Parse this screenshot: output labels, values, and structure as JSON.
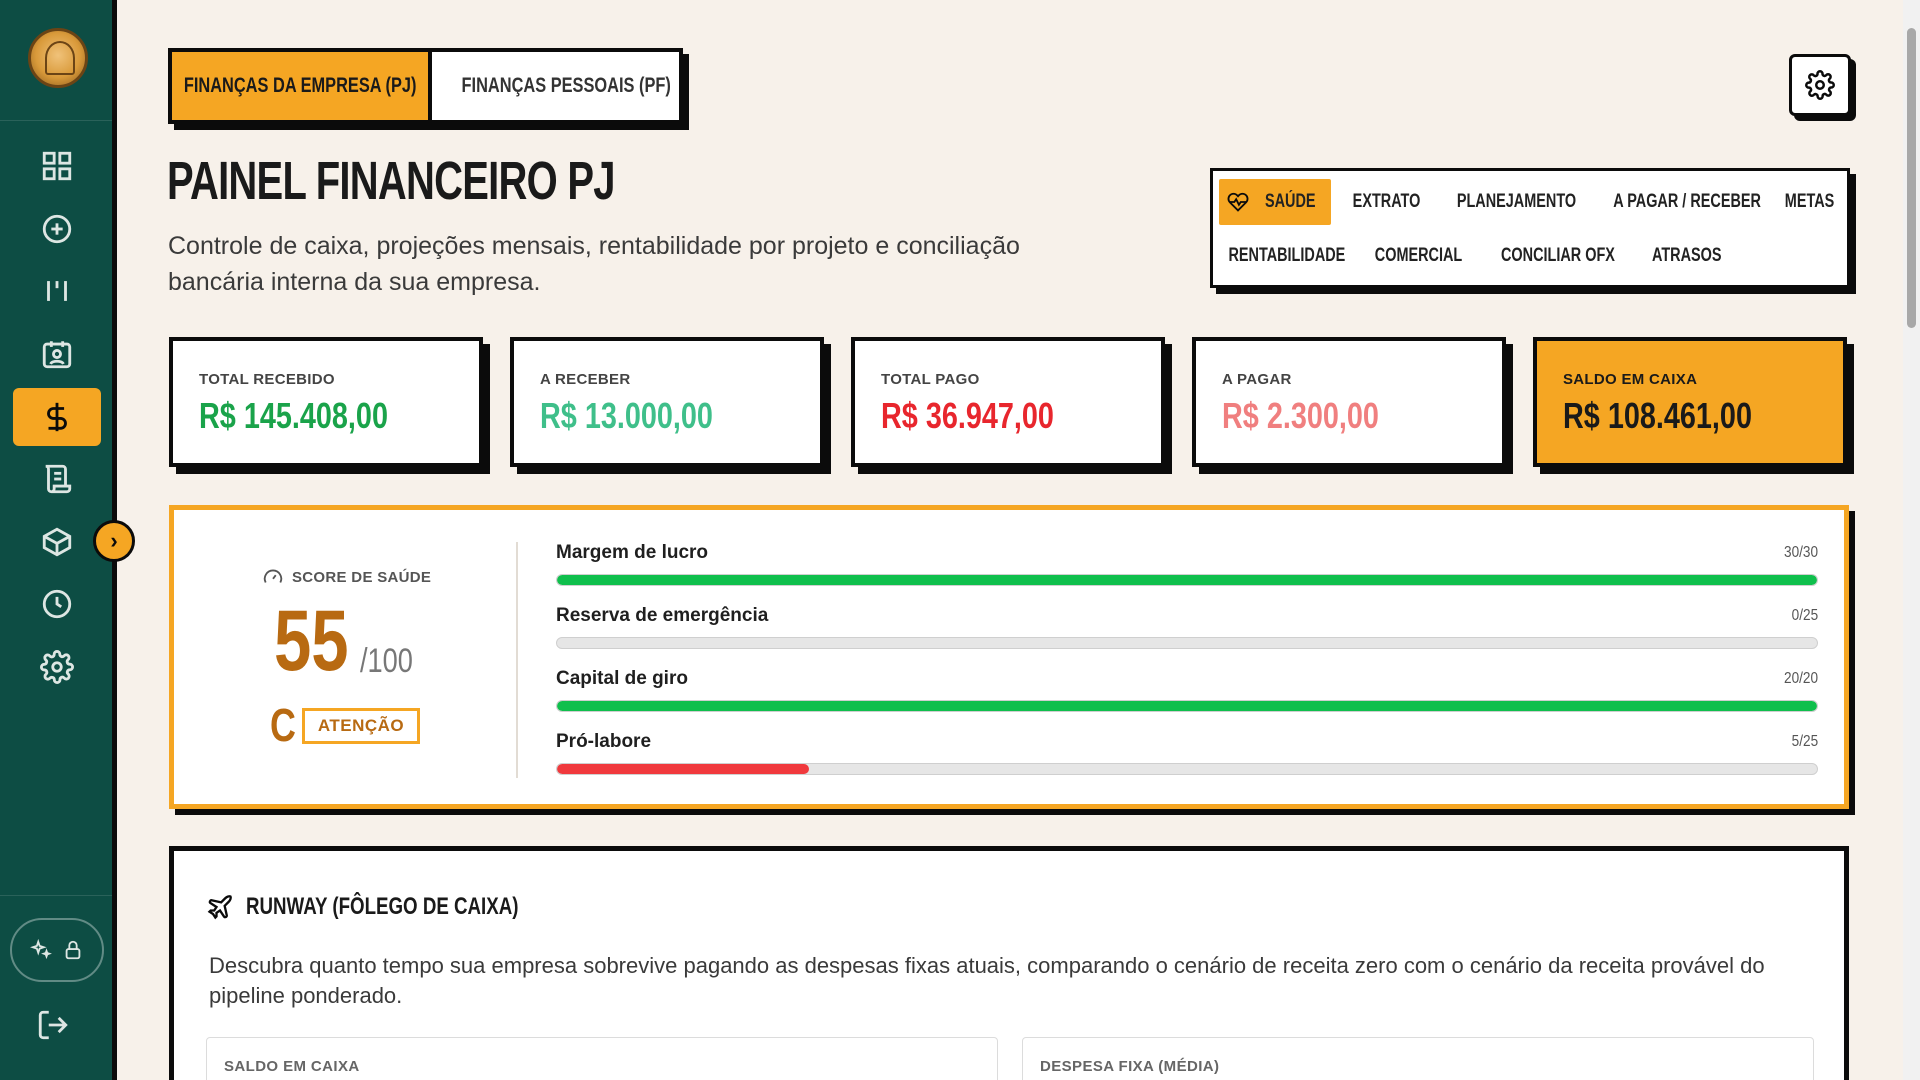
{
  "sidebar": {
    "items": [
      {
        "icon": "grid-icon",
        "active": false
      },
      {
        "icon": "plus-circle-icon",
        "active": false
      },
      {
        "icon": "kanban-icon",
        "active": false
      },
      {
        "icon": "calendar-user-icon",
        "active": false
      },
      {
        "icon": "dollar-icon",
        "active": true
      },
      {
        "icon": "scroll-icon",
        "active": false
      },
      {
        "icon": "box-icon",
        "active": false
      },
      {
        "icon": "clock-icon",
        "active": false
      },
      {
        "icon": "gear-icon",
        "active": false
      }
    ],
    "collapse_glyph": "›"
  },
  "top_toggle": {
    "company": "FINANÇAS DA EMPRESA (PJ)",
    "personal": "FINANÇAS PESSOAIS (PF)"
  },
  "header": {
    "title": "PAINEL FINANCEIRO PJ",
    "subtitle": "Controle de caixa, projeções mensais, rentabilidade por projeto e conciliação bancária interna da sua empresa."
  },
  "tabs": [
    {
      "label": "SAÚDE",
      "active": true
    },
    {
      "label": "EXTRATO"
    },
    {
      "label": "PLANEJAMENTO"
    },
    {
      "label": "A PAGAR / RECEBER"
    },
    {
      "label": "METAS"
    },
    {
      "label": "RENTABILIDADE"
    },
    {
      "label": "COMERCIAL"
    },
    {
      "label": "CONCILIAR OFX"
    },
    {
      "label": "ATRASOS"
    }
  ],
  "stats": [
    {
      "label": "TOTAL RECEBIDO",
      "value": "R$ 145.408,00",
      "color": "#1aa34a"
    },
    {
      "label": "A RECEBER",
      "value": "R$ 13.000,00",
      "color": "#3fbf8a"
    },
    {
      "label": "TOTAL PAGO",
      "value": "R$ 36.947,00",
      "color": "#e8262d"
    },
    {
      "label": "A PAGAR",
      "value": "R$ 2.300,00",
      "color": "#f07f7f"
    },
    {
      "label": "SALDO EM CAIXA",
      "value": "R$ 108.461,00",
      "color": "#1a1a1a"
    }
  ],
  "health": {
    "label": "SCORE DE SAÚDE",
    "score": "55",
    "score_of": "/100",
    "grade": "C",
    "status": "ATENÇÃO",
    "metrics": [
      {
        "name": "Margem de lucro",
        "score": "30/30",
        "fraction": 1.0,
        "color": "#0fbf4c"
      },
      {
        "name": "Reserva de emergência",
        "score": "0/25",
        "fraction": 0.0,
        "color": "#0fbf4c"
      },
      {
        "name": "Capital de giro",
        "score": "20/20",
        "fraction": 1.0,
        "color": "#0fbf4c"
      },
      {
        "name": "Pró-labore",
        "score": "5/25",
        "fraction": 0.2,
        "color": "#f0393d"
      }
    ]
  },
  "runway": {
    "title": "RUNWAY (FÔLEGO DE CAIXA)",
    "description": "Descubra quanto tempo sua empresa sobrevive pagando as despesas fixas atuais, comparando o cenário de receita zero com o cenário da receita provável do pipeline ponderado.",
    "boxes": [
      "SALDO EM CAIXA",
      "DESPESA FIXA (MÉDIA)"
    ]
  },
  "colors": {
    "sidebar": "#0d4d44",
    "accent": "#f5a623",
    "background": "#f7f1ea"
  }
}
